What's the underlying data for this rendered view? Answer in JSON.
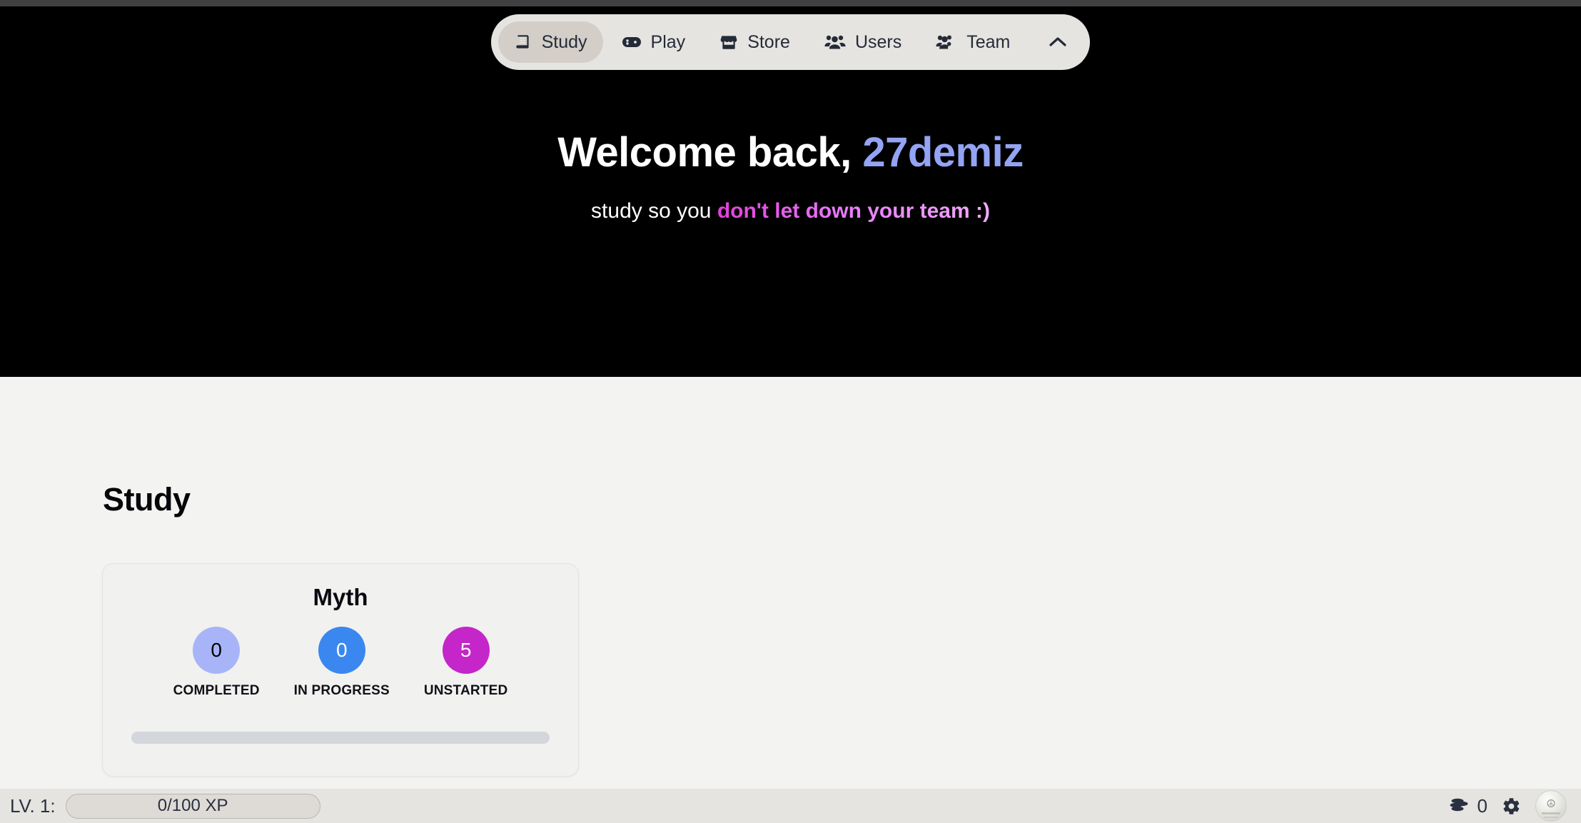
{
  "nav": {
    "items": [
      {
        "label": "Study",
        "icon": "book-icon",
        "active": true
      },
      {
        "label": "Play",
        "icon": "gamepad-icon",
        "active": false
      },
      {
        "label": "Store",
        "icon": "store-icon",
        "active": false
      },
      {
        "label": "Users",
        "icon": "users-icon",
        "active": false
      },
      {
        "label": "Team",
        "icon": "users-cog-icon",
        "active": false
      }
    ],
    "collapse_icon": "chevron-up-icon"
  },
  "hero": {
    "greeting": "Welcome back, ",
    "username": "27demiz",
    "subtitle_plain": "study so you ",
    "subtitle_accent": "don't let down your team :)",
    "username_color": "#93a4f4",
    "accent_color": "#e040d8",
    "background_color": "#000000"
  },
  "main": {
    "page_title": "Study",
    "card": {
      "title": "Myth",
      "stats": [
        {
          "label": "COMPLETED",
          "value": "0",
          "color": "#a8b4f8",
          "text_color": "#000000"
        },
        {
          "label": "IN PROGRESS",
          "value": "0",
          "color": "#3b87f0",
          "text_color": "#ffffff"
        },
        {
          "label": "UNSTARTED",
          "value": "5",
          "color": "#c426c9",
          "text_color": "#ffffff"
        }
      ],
      "progress_percent": 0
    }
  },
  "statusbar": {
    "level_label": "LV. 1:",
    "xp_text": "0/100 XP",
    "coins_icon": "coins-icon",
    "coins_count": "0",
    "settings_icon": "gear-icon",
    "avatar_icon": "user-avatar",
    "background_color": "#e5e4e0"
  }
}
